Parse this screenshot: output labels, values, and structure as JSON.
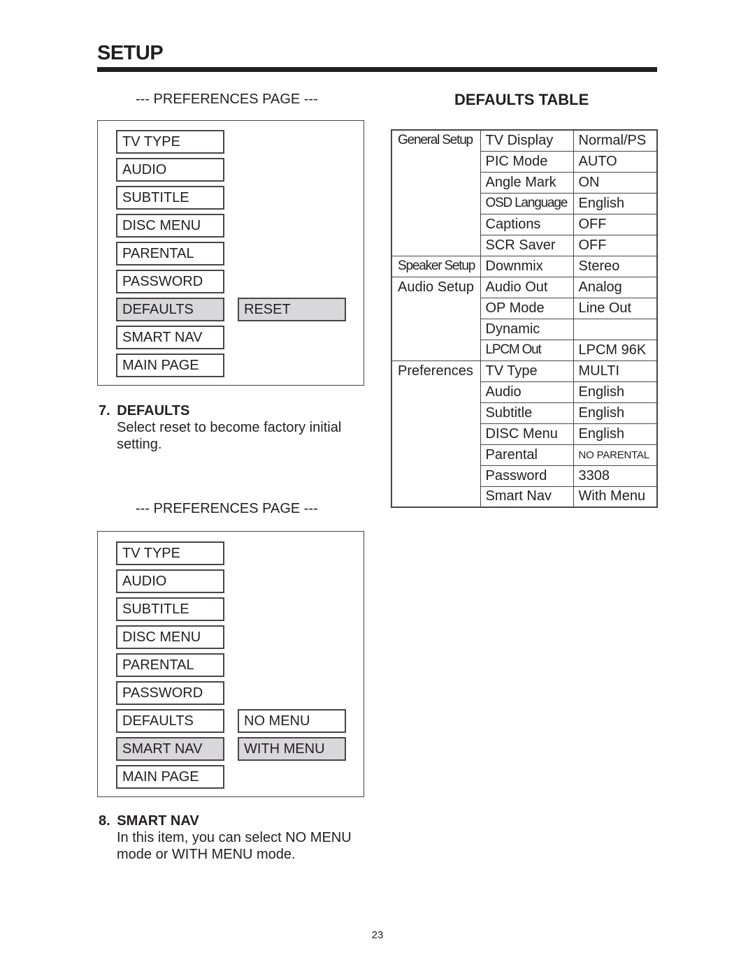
{
  "page": {
    "title": "SETUP",
    "page_number": "23"
  },
  "left": {
    "panel1": {
      "heading": "--- PREFERENCES PAGE ---",
      "menu_items": [
        "TV TYPE",
        "AUDIO",
        "SUBTITLE",
        "DISC MENU",
        "PARENTAL",
        "PASSWORD",
        "DEFAULTS",
        "SMART NAV",
        "MAIN PAGE"
      ],
      "highlighted_item": "DEFAULTS",
      "options": [
        "RESET"
      ],
      "highlighted_option": "RESET"
    },
    "section7": {
      "number": "7.",
      "title": "DEFAULTS",
      "body_line1": "Select reset to become factory initial",
      "body_line2": "setting."
    },
    "panel2": {
      "heading": "--- PREFERENCES PAGE ---",
      "menu_items": [
        "TV TYPE",
        "AUDIO",
        "SUBTITLE",
        "DISC MENU",
        "PARENTAL",
        "PASSWORD",
        "DEFAULTS",
        "SMART NAV",
        "MAIN PAGE"
      ],
      "highlighted_item": "SMART NAV",
      "options": [
        "NO MENU",
        "WITH MENU"
      ],
      "highlighted_option": "WITH MENU"
    },
    "section8": {
      "number": "8.",
      "title": "SMART NAV",
      "body_line1": "In this item, you can select NO MENU",
      "body_line2": "mode or WITH MENU mode."
    }
  },
  "defaults_table": {
    "title": "DEFAULTS TABLE",
    "rows": [
      {
        "group": "General Setup",
        "setting": "TV Display",
        "value": "Normal/PS"
      },
      {
        "group": "",
        "setting": "PIC Mode",
        "value": "AUTO"
      },
      {
        "group": "",
        "setting": "Angle Mark",
        "value": "ON"
      },
      {
        "group": "",
        "setting": "OSD Language",
        "value": "English"
      },
      {
        "group": "",
        "setting": "Captions",
        "value": "OFF"
      },
      {
        "group": "",
        "setting": "SCR Saver",
        "value": "OFF"
      },
      {
        "group": "Speaker Setup",
        "setting": "Downmix",
        "value": "Stereo"
      },
      {
        "group": "Audio Setup",
        "setting": "Audio Out",
        "value": "Analog"
      },
      {
        "group": "",
        "setting": "OP Mode",
        "value": "Line Out"
      },
      {
        "group": "",
        "setting": "Dynamic",
        "value": ""
      },
      {
        "group": "",
        "setting": "LPCM Out",
        "value": "LPCM 96K"
      },
      {
        "group": "Preferences",
        "setting": "TV Type",
        "value": "MULTI"
      },
      {
        "group": "",
        "setting": "Audio",
        "value": "English"
      },
      {
        "group": "",
        "setting": "Subtitle",
        "value": "English"
      },
      {
        "group": "",
        "setting": "DISC Menu",
        "value": "English"
      },
      {
        "group": "",
        "setting": "Parental",
        "value": "NO PARENTAL"
      },
      {
        "group": "",
        "setting": "Password",
        "value": "3308"
      },
      {
        "group": "",
        "setting": "Smart Nav",
        "value": "With Menu"
      }
    ]
  }
}
